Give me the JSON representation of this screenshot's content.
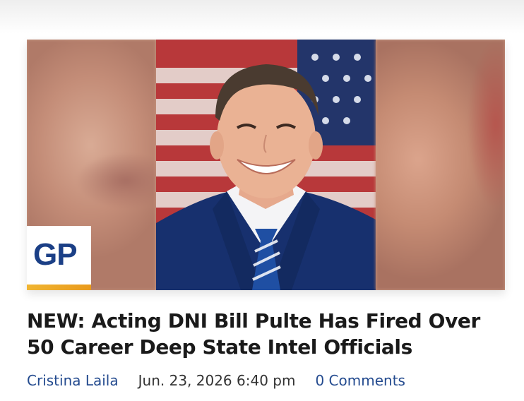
{
  "article": {
    "headline": "NEW: Acting DNI Bill Pulte Has Fired Over 50 Career Deep State Intel Officials",
    "author": "Cristina Laila",
    "date": "Jun. 23, 2026 6:40 pm",
    "comments": "0 Comments"
  },
  "image": {
    "subject": "portrait",
    "logo_text": "GP"
  },
  "colors": {
    "link": "#244b8f",
    "logo_blue": "#1b3f86",
    "logo_bar": "#f0b532",
    "text": "#1a1a1a"
  }
}
